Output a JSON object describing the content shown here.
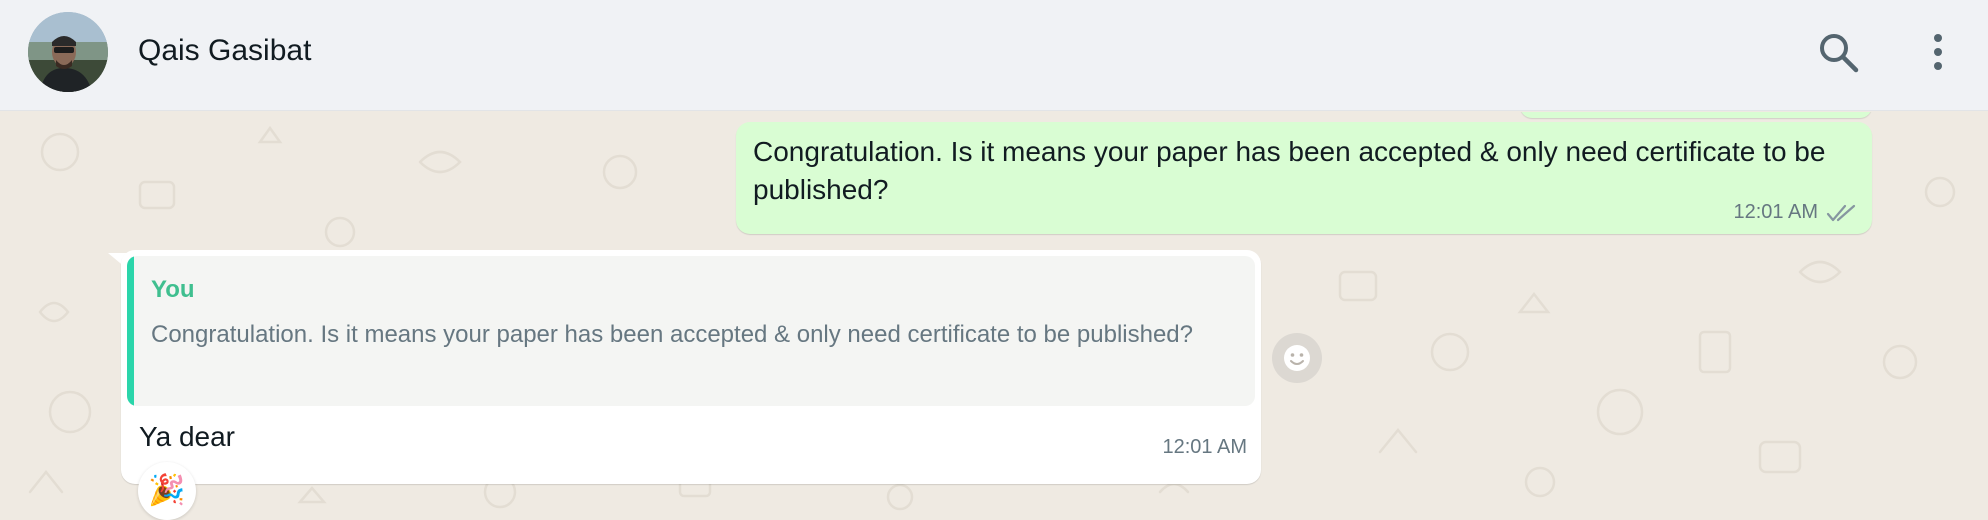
{
  "header": {
    "contact_name": "Qais Gasibat",
    "avatar_icon": "contact-avatar",
    "search_icon": "search-icon",
    "menu_icon": "more-vertical-icon"
  },
  "messages": [
    {
      "direction": "outgoing",
      "text": "Congratulation. Is it means your paper has been accepted & only need certificate to be published?",
      "time": "12:01 AM",
      "status": "read",
      "status_icon": "double-check-icon"
    },
    {
      "direction": "incoming",
      "quoted": {
        "author": "You",
        "text": "Congratulation. Is it means your paper has been accepted & only need certificate to be published?"
      },
      "text": "Ya dear",
      "time": "12:01 AM",
      "reaction": "🎉"
    }
  ],
  "colors": {
    "header_bg": "#f0f2f5",
    "chat_bg": "#efeae2",
    "outgoing_bubble": "#d9fdd3",
    "incoming_bubble": "#ffffff",
    "quote_accent": "#06cf9c"
  }
}
